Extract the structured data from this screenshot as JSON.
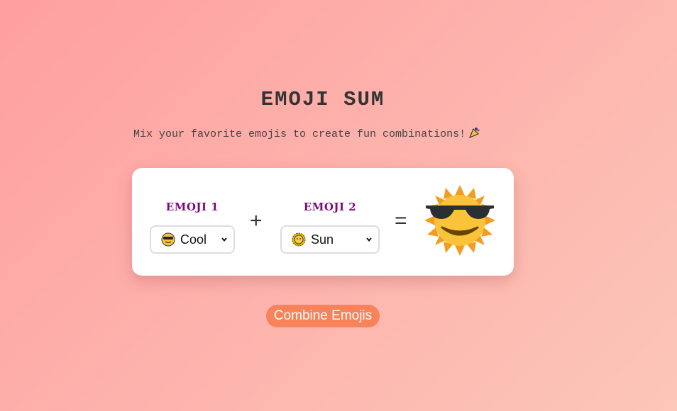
{
  "header": {
    "title": "EMOJI SUM",
    "subtitle": "Mix your favorite emojis to create fun combinations!",
    "subtitle_icon": "party-popper-icon"
  },
  "mixer": {
    "emoji1": {
      "label": "EMOJI 1",
      "selected": "Cool",
      "icon": "smiling-face-with-sunglasses-icon"
    },
    "plus": "+",
    "emoji2": {
      "label": "EMOJI 2",
      "selected": "Sun",
      "icon": "sun-with-face-icon"
    },
    "equals": "=",
    "result_icon": "sun-with-sunglasses-icon"
  },
  "actions": {
    "combine_label": "Combine Emojis"
  },
  "colors": {
    "label": "#7a0a7a",
    "button": "#f8825a",
    "card": "#ffffff"
  }
}
